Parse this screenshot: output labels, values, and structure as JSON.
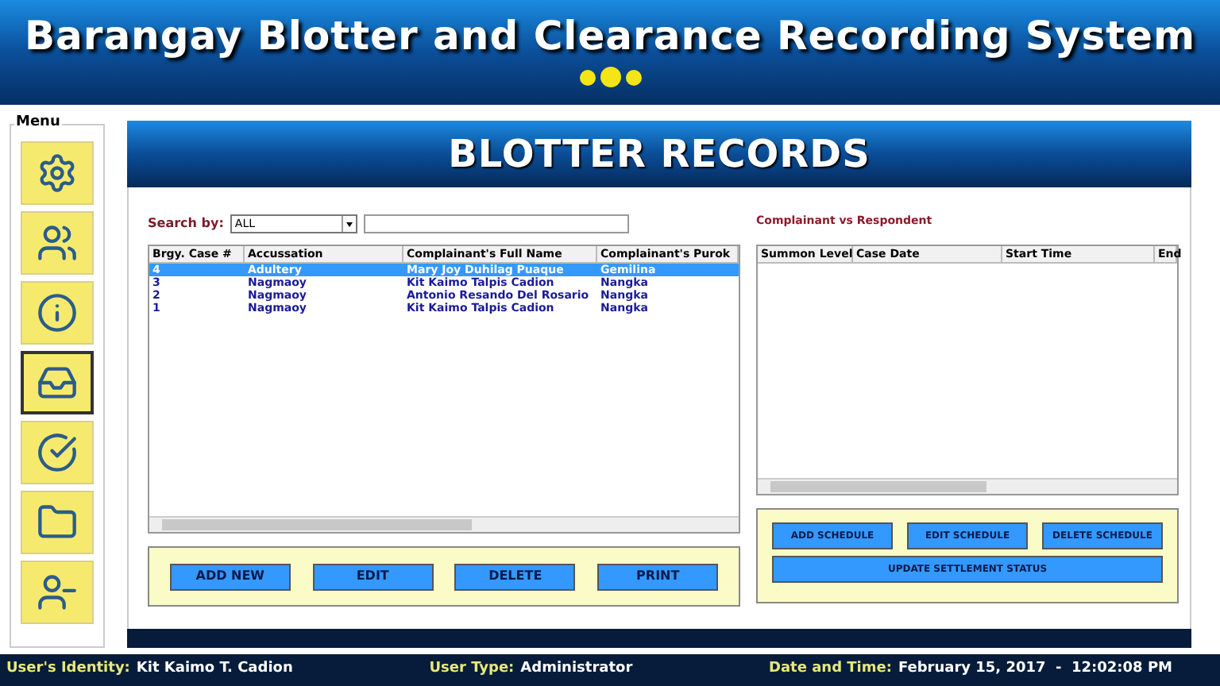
{
  "header": {
    "title": "Barangay Blotter and Clearance Recording System"
  },
  "menu": {
    "label": "Menu",
    "items": [
      {
        "kind": "settings",
        "selected": false
      },
      {
        "kind": "people",
        "selected": false
      },
      {
        "kind": "info",
        "selected": false
      },
      {
        "kind": "records",
        "selected": true
      },
      {
        "kind": "check",
        "selected": false
      },
      {
        "kind": "folder",
        "selected": false
      },
      {
        "kind": "remove",
        "selected": false
      }
    ]
  },
  "panel": {
    "title": "BLOTTER RECORDS"
  },
  "search": {
    "label": "Search by:",
    "option": "ALL"
  },
  "blotter_table": {
    "columns": [
      "Brgy. Case #",
      "Accussation",
      "Complainant's Full Name",
      "Complainant's Purok"
    ],
    "rows": [
      {
        "cells": [
          "4",
          "Adultery",
          "Mary Joy Duhilag Puaque",
          "Gemilina"
        ],
        "selected": true
      },
      {
        "cells": [
          "3",
          "Nagmaoy",
          "Kit Kaimo Talpis Cadion",
          "Nangka"
        ],
        "selected": false
      },
      {
        "cells": [
          "2",
          "Nagmaoy",
          "Antonio Resando Del Rosario",
          "Nangka"
        ],
        "selected": false
      },
      {
        "cells": [
          "1",
          "Nagmaoy",
          "Kit Kaimo Talpis Cadion",
          "Nangka"
        ],
        "selected": false
      }
    ]
  },
  "record_buttons": [
    "ADD NEW",
    "EDIT",
    "DELETE",
    "PRINT"
  ],
  "schedule": {
    "label": "Complainant vs Respondent",
    "columns": [
      "Summon Level",
      "Case Date",
      "Start Time",
      "End"
    ],
    "buttons": [
      "ADD SCHEDULE",
      "EDIT SCHEDULE",
      "DELETE SCHEDULE"
    ],
    "wide_button": "UPDATE SETTLEMENT STATUS"
  },
  "status_bar": [
    {
      "label": "User's Identity:",
      "value": "Kit Kaimo T. Cadion"
    },
    {
      "label": "User Type:",
      "value": "Administrator"
    },
    {
      "label": "Date and Time:",
      "value": "February 15, 2017  -  12:02:08 PM"
    }
  ]
}
